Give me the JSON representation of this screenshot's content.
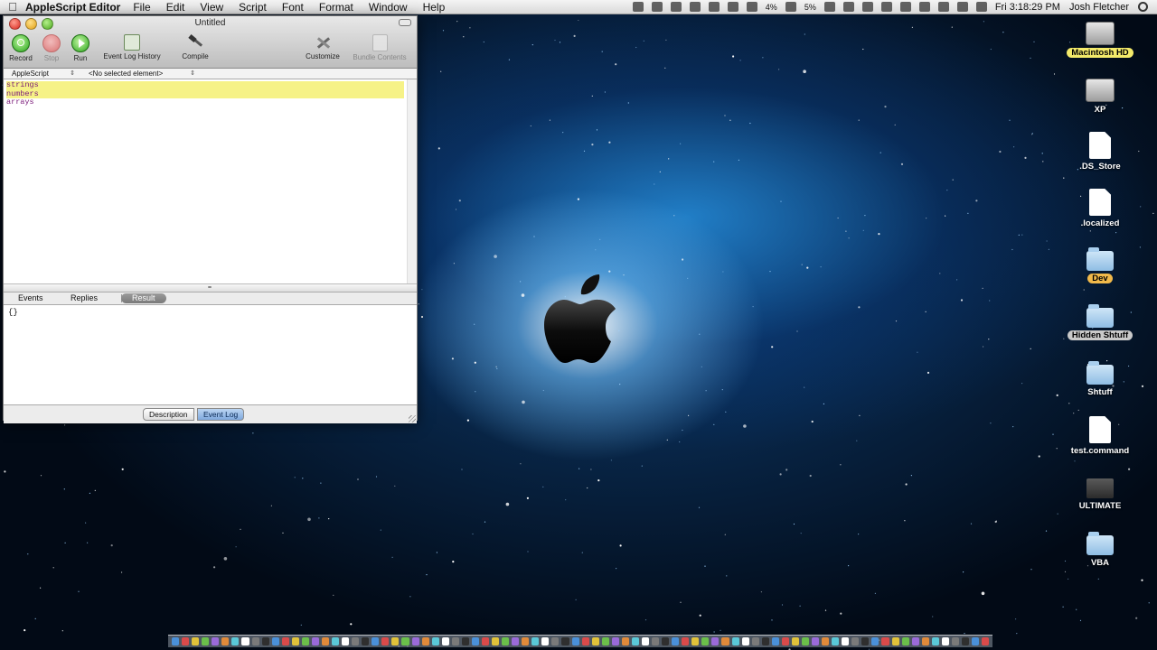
{
  "menubar": {
    "app_name": "AppleScript Editor",
    "menus": [
      "File",
      "Edit",
      "View",
      "Script",
      "Font",
      "Format",
      "Window",
      "Help"
    ],
    "battery_percent_1": "4%",
    "battery_percent_2": "5%",
    "clock": "Fri 3:18:29 PM",
    "user": "Josh Fletcher"
  },
  "window": {
    "title": "Untitled",
    "toolbar": {
      "record": "Record",
      "stop": "Stop",
      "run": "Run",
      "event_log_history": "Event Log History",
      "compile": "Compile",
      "customize": "Customize",
      "bundle_contents": "Bundle Contents"
    },
    "navbar": {
      "language": "AppleScript",
      "element": "<No selected element>"
    },
    "editor": {
      "lines": [
        "strings",
        "numbers",
        "arrays"
      ]
    },
    "tabs": {
      "events": "Events",
      "replies": "Replies",
      "result": "Result"
    },
    "result_text": "{}",
    "bottom": {
      "description": "Description",
      "event_log": "Event Log"
    }
  },
  "desktop": {
    "items": [
      {
        "label": "Macintosh HD",
        "kind": "drive"
      },
      {
        "label": "XP",
        "kind": "drive"
      },
      {
        "label": ".DS_Store",
        "kind": "document"
      },
      {
        "label": ".localized",
        "kind": "document"
      },
      {
        "label": "Dev",
        "kind": "folder"
      },
      {
        "label": "Hidden Shtuff",
        "kind": "folder"
      },
      {
        "label": "Shtuff",
        "kind": "folder"
      },
      {
        "label": "test.command",
        "kind": "document"
      },
      {
        "label": "ULTIMATE",
        "kind": "executable"
      },
      {
        "label": "VBA",
        "kind": "folder"
      }
    ]
  },
  "colors": {
    "editor_highlight": "#f6f287",
    "label_yellow": "#f3ea6a",
    "label_orange": "#f1b94a",
    "label_gray": "#c9c9c9"
  }
}
